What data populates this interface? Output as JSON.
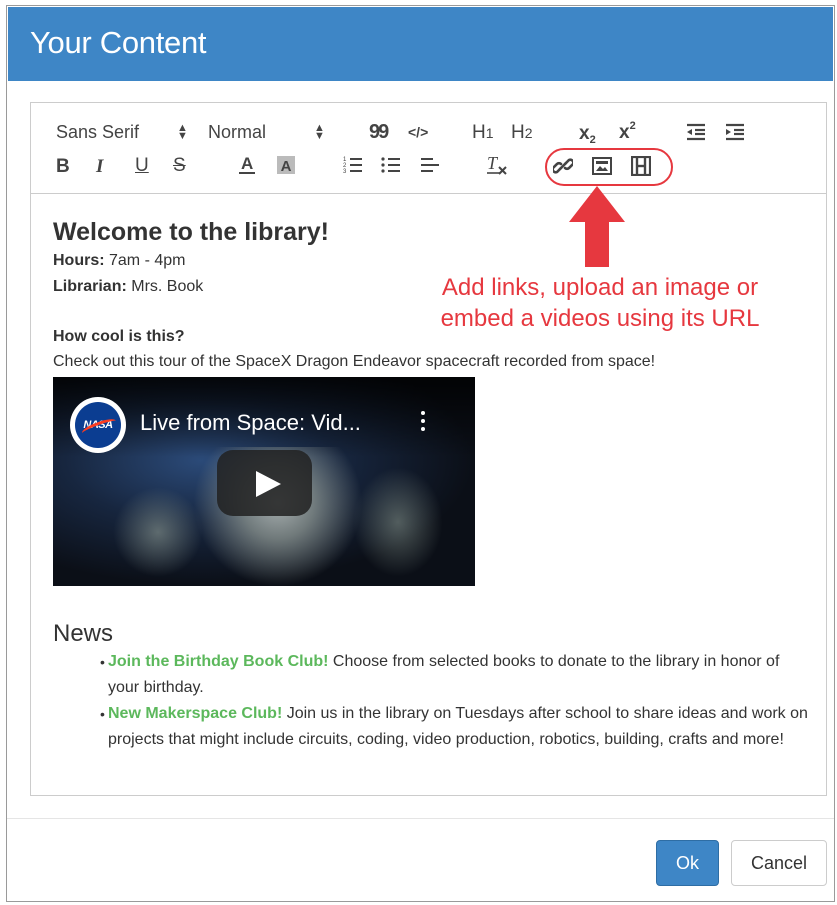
{
  "modal": {
    "title": "Your Content",
    "ok_label": "Ok",
    "cancel_label": "Cancel",
    "colors": {
      "header": "#3e86c6",
      "annotation": "#e6383f",
      "link": "#5cb85c"
    }
  },
  "toolbar": {
    "font_select": "Sans Serif",
    "size_select": "Normal",
    "quote_glyph": "99",
    "code_glyph": "</>",
    "h1_label": "H1",
    "h2_label": "H2",
    "bold": "B",
    "italic": "I",
    "underline": "U",
    "strike": "S",
    "font_color": "A",
    "icons": [
      "blockquote-icon",
      "code-icon",
      "heading1-icon",
      "heading2-icon",
      "subscript-icon",
      "superscript-icon",
      "outdent-icon",
      "indent-icon",
      "bold-icon",
      "italic-icon",
      "underline-icon",
      "strike-icon",
      "font-color-icon",
      "background-color-icon",
      "ordered-list-icon",
      "bullet-list-icon",
      "align-icon",
      "clear-format-icon",
      "link-icon",
      "image-icon",
      "video-icon"
    ]
  },
  "annotation": {
    "line1": "Add links, upload an image or",
    "line2": "embed a videos using its URL"
  },
  "content": {
    "heading": "Welcome to the library!",
    "hours_label": "Hours:",
    "hours_value": " 7am - 4pm",
    "librarian_label": "Librarian:",
    "librarian_value": " Mrs. Book",
    "cool_heading": "How cool is this?",
    "tour_text": "Check out this tour of the SpaceX Dragon Endeavor spacecraft recorded from space!",
    "video": {
      "channel_logo_text": "NASA",
      "title": "Live from Space: Vid..."
    },
    "news_heading": "News",
    "news": [
      {
        "link": "Join the Birthday Book Club!",
        "text": " Choose from selected books to donate to the library in honor of your birthday."
      },
      {
        "link": "New Makerspace Club!",
        "text": " Join us in the library on Tuesdays after school to share ideas and work on projects that might include circuits, coding, video production, robotics, building, crafts and more!"
      }
    ]
  }
}
